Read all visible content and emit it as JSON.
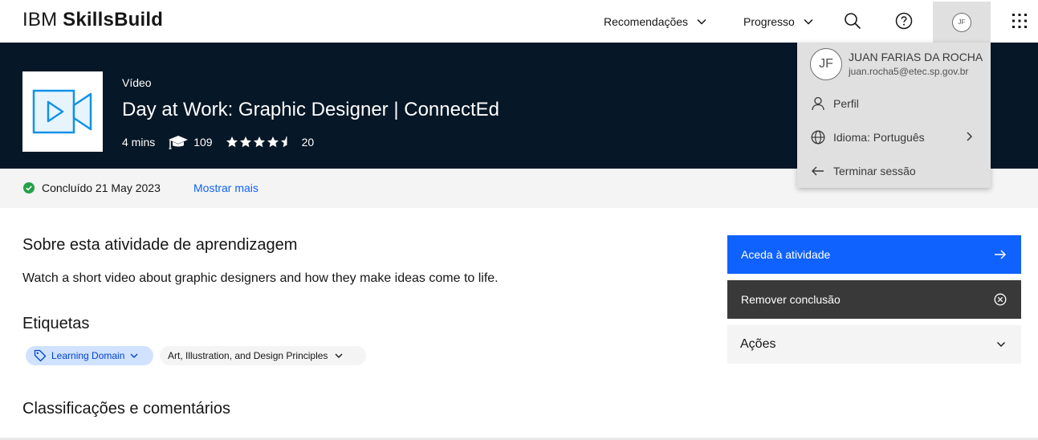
{
  "header": {
    "brand_prefix": "IBM",
    "brand_name": "SkillsBuild",
    "nav_recommendations": "Recomendações",
    "nav_progress": "Progresso",
    "avatar_initials": "JF"
  },
  "hero": {
    "content_type": "Vídeo",
    "title": "Day at Work: Graphic Designer | ConnectEd",
    "duration": "4 mins",
    "enrolled_count": "109",
    "rating_stars": 4.5,
    "rating_count": "20"
  },
  "completion": {
    "status_text": "Concluído 21 May 2023",
    "show_more_link": "Mostrar mais",
    "status_color": "#24a148"
  },
  "about": {
    "heading": "Sobre esta atividade de aprendizagem",
    "description": "Watch a short video about graphic designers and how they make ideas come to life."
  },
  "tags": {
    "heading": "Etiquetas",
    "items": [
      {
        "label": "Learning Domain",
        "icon": "tag-icon"
      },
      {
        "label": "Art, Illustration, and Design Principles"
      }
    ]
  },
  "ratings": {
    "heading": "Classificações e comentários"
  },
  "actions": {
    "access_label": "Aceda à atividade",
    "remove_label": "Remover conclusão",
    "more_label": "Ações"
  },
  "profile_menu": {
    "initials": "JF",
    "name": "JUAN FARIAS DA ROCHA",
    "email": "juan.rocha5@etec.sp.gov.br",
    "items": [
      {
        "label": "Perfil",
        "icon": "user-icon"
      },
      {
        "label": "Idioma: Português",
        "icon": "globe-icon"
      },
      {
        "label": "Terminar sessão",
        "icon": "arrow-left-icon"
      }
    ]
  },
  "colors": {
    "hero_bg": "#061727",
    "primary_button": "#0f62fe",
    "secondary_button": "#393939",
    "link": "#0f62fe",
    "tag_domain_bg": "#d0e2ff"
  }
}
